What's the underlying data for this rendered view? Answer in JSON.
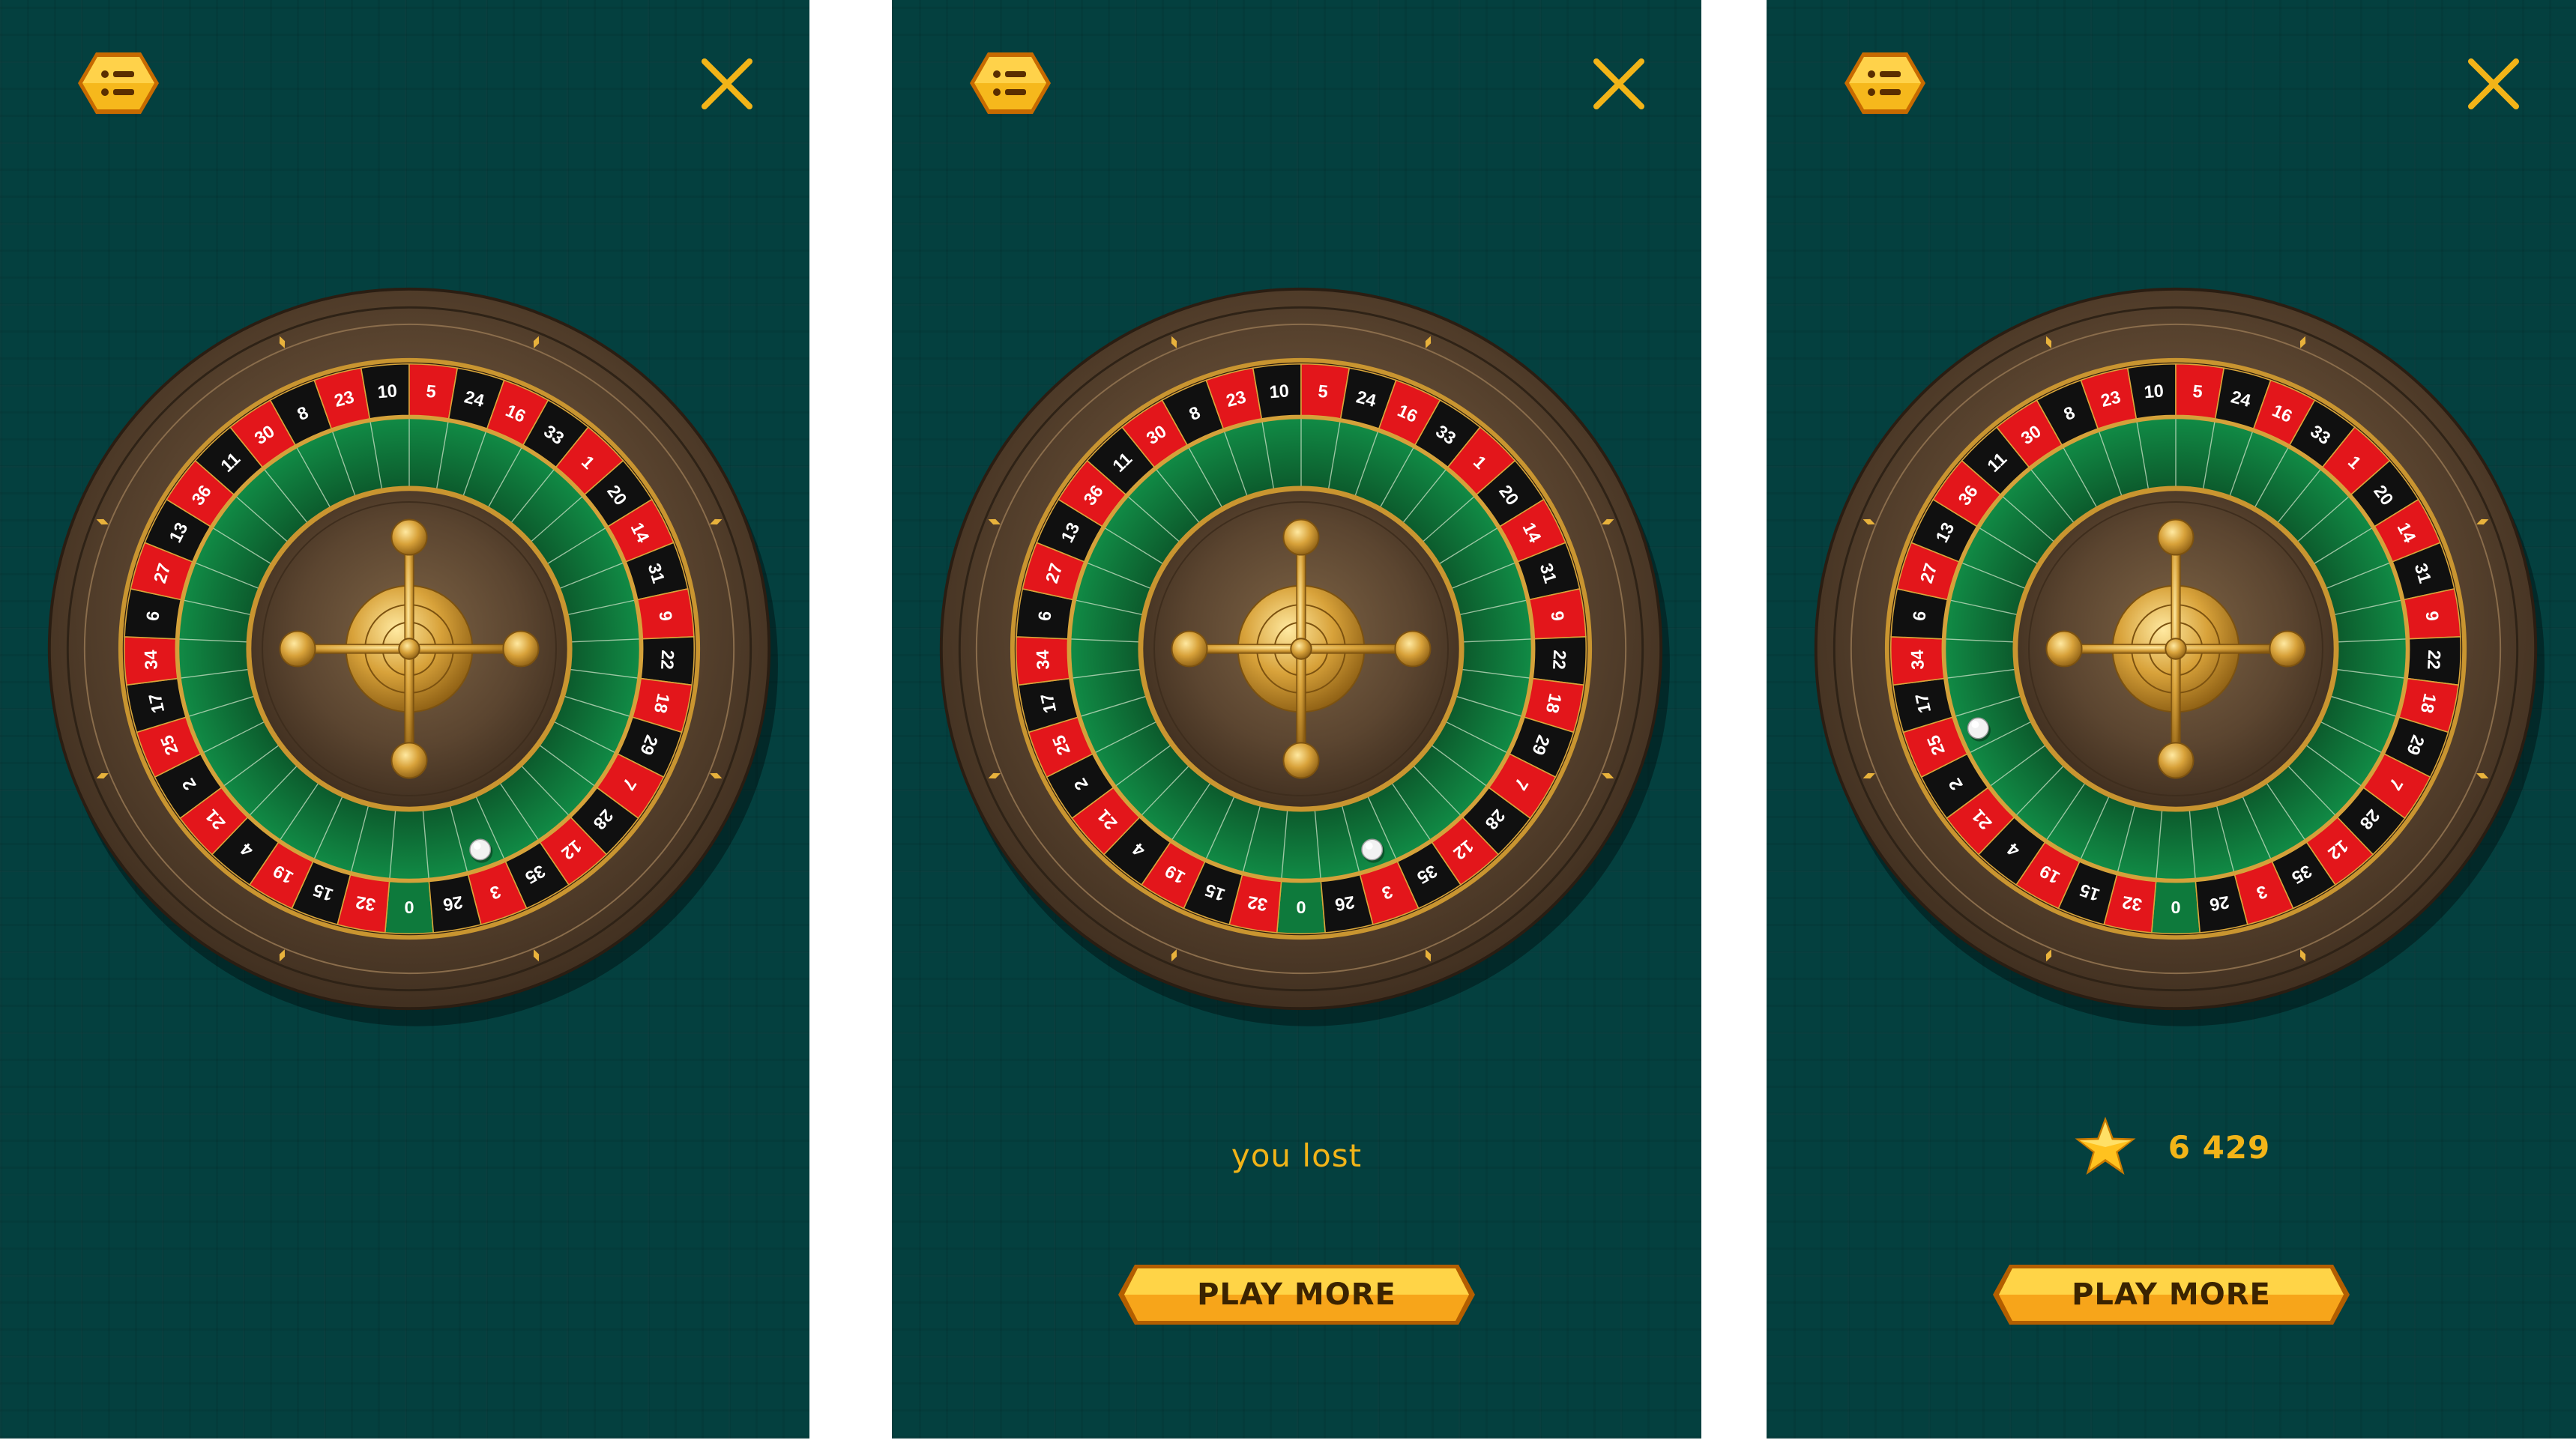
{
  "screens": [
    {
      "menu_icon": "menu-list-icon",
      "close_icon": "close-x-icon",
      "ball_number": "3",
      "result_text": "",
      "score_value": "",
      "button_label": ""
    },
    {
      "menu_icon": "menu-list-icon",
      "close_icon": "close-x-icon",
      "ball_number": "3",
      "result_text": "you lost",
      "score_value": "",
      "button_label": "PLAY MORE"
    },
    {
      "menu_icon": "menu-list-icon",
      "close_icon": "close-x-icon",
      "ball_number": "25",
      "result_text": "",
      "score_icon": "star-icon",
      "score_value": "6 429",
      "button_label": "PLAY MORE"
    }
  ],
  "wheel": {
    "numbers": [
      "0",
      "32",
      "15",
      "19",
      "4",
      "21",
      "2",
      "25",
      "17",
      "34",
      "6",
      "27",
      "13",
      "36",
      "11",
      "30",
      "8",
      "23",
      "10",
      "5",
      "24",
      "16",
      "33",
      "1",
      "20",
      "14",
      "31",
      "9",
      "22",
      "18",
      "29",
      "7",
      "28",
      "12",
      "35",
      "3",
      "26"
    ],
    "colors": {
      "red": "#e3161b",
      "black": "#101010",
      "green": "#0e7a3c"
    }
  },
  "colors": {
    "background": "#04403f",
    "accent": "#f2b418"
  }
}
